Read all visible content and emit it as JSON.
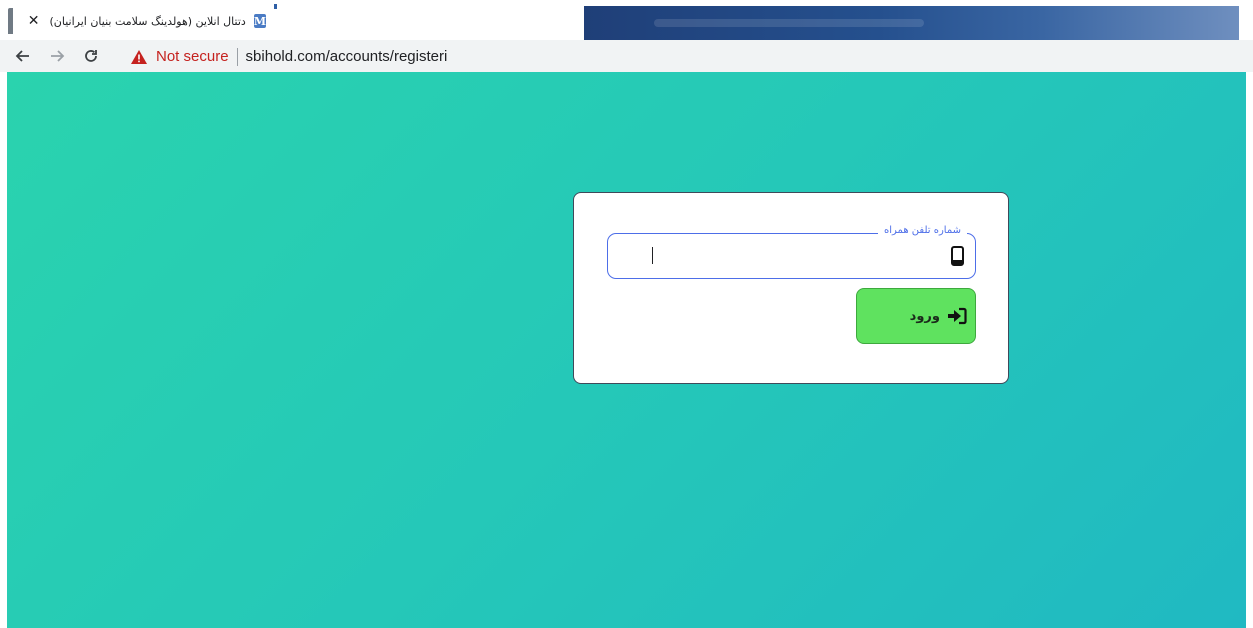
{
  "browser": {
    "tab": {
      "favicon_letter": "M",
      "title": "دتتال انلاین (هولدینگ سلامت بنیان ایرانیان)",
      "close_glyph": "✕"
    },
    "address_bar": {
      "security_label": "Not secure",
      "url": "sbihold.com/accounts/registeri"
    },
    "icons": {
      "back": "back-arrow-icon",
      "forward": "forward-arrow-icon",
      "reload": "reload-icon",
      "security": "warning-triangle-icon"
    }
  },
  "page": {
    "colors": {
      "gradient_start": "#2ad3ae",
      "gradient_end": "#20b9c2",
      "field_accent": "#4d6ee8",
      "button_bg": "#5fe25f"
    },
    "login_form": {
      "phone_label": "شماره تلفن همراه",
      "phone_value": "",
      "phone_icon": "mobile-phone-icon",
      "submit_label": "ورود",
      "submit_icon": "sign-in-icon"
    }
  }
}
